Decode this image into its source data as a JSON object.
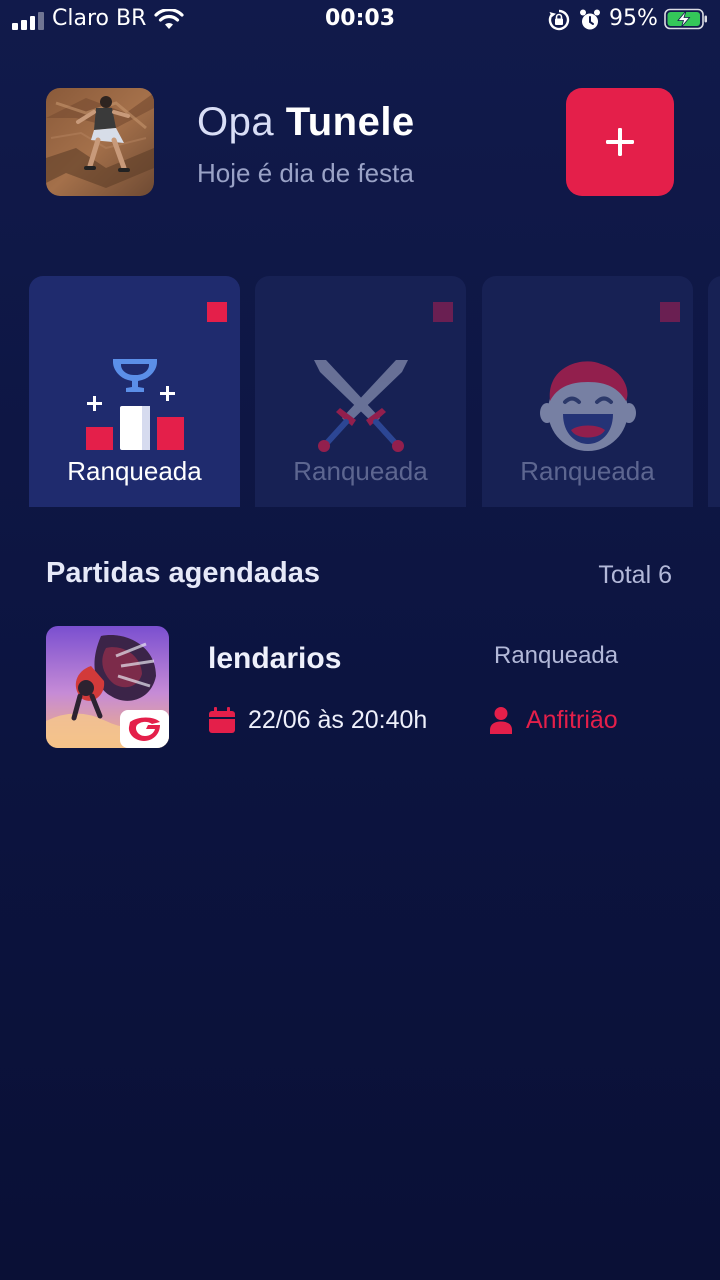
{
  "status_bar": {
    "carrier": "Claro BR",
    "time": "00:03",
    "battery": "95%"
  },
  "header": {
    "greeting_prefix": "Opa",
    "user_name": "Tunele",
    "subtitle": "Hoje é dia de festa",
    "add_label": "+"
  },
  "modes": [
    {
      "label": "Ranqueada",
      "icon": "trophy-podium-icon",
      "active": true
    },
    {
      "label": "Ranqueada",
      "icon": "crossed-swords-icon",
      "active": false
    },
    {
      "label": "Ranqueada",
      "icon": "laughing-face-icon",
      "active": false
    }
  ],
  "scheduled": {
    "title": "Partidas agendadas",
    "total": "Total 6",
    "items": [
      {
        "name": "lendarios",
        "mode": "Ranqueada",
        "date": "22/06 às 20:40h",
        "role": "Anfitrião",
        "thumbnail": "free-fire-game-icon"
      }
    ]
  },
  "colors": {
    "background": "#0c1440",
    "accent": "#e41f4a",
    "card_active": "#1f2b6e",
    "card_inactive": "#172154"
  }
}
